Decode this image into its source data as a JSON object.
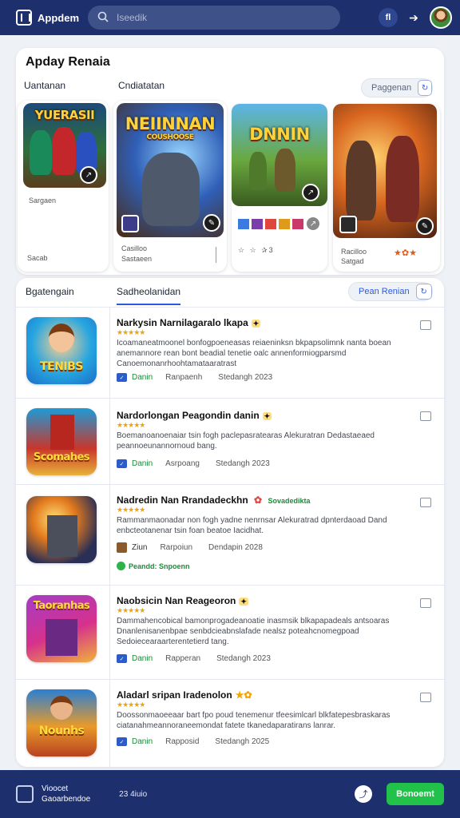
{
  "header": {
    "app_name": "Appdem",
    "search_placeholder": "Iseedik",
    "circle_label": "fl",
    "arrow_label": "➔"
  },
  "featured": {
    "title": "Apday Renaia",
    "tabs": [
      "Uantanan",
      "Cndiatatan"
    ],
    "button_label": "Paggenan",
    "cards": [
      {
        "art_text": "YUERASII",
        "label1": "Sargaen",
        "label2": "Sacab"
      },
      {
        "art_text": "NEIINNAN",
        "art_sub": "COUSHOOSE",
        "label1": "Casilloo",
        "label2": "Sastaeen"
      },
      {
        "art_text": "DNNIN",
        "rating_text": "☆ ☆ ✰3"
      },
      {
        "label1": "Racilloo",
        "label2": "Satgad"
      }
    ],
    "accent_colors": [
      "#2b5be0",
      "#22c24a",
      "#f4a300"
    ]
  },
  "list": {
    "tabs": [
      "Bgatengain",
      "Sadheolanidan"
    ],
    "button_label": "Pean Renian",
    "items": [
      {
        "thumb_text": "TENIBS",
        "title": "Narkysin Narnilagaralo lkapa",
        "stars": "★★★★★",
        "description": "Icoamaneatmoonel bonfogpoeneasas reiaeninksn bkpapsolimnk nanta boean anemannore rean bont beadial tenetie oalc annenformiogparsmd Canoemonanrhoohtamataaratrast",
        "publisher": "Danin",
        "category": "Ranpaenh",
        "date": "Stedangh 2023"
      },
      {
        "thumb_text": "Scomahes",
        "title": "Nardorlongan Peagondin danin",
        "stars": "★★★★★",
        "description": "Boemanoanoenaiar tsin fogh paclepasratearas Alekuratran Dedastaeaed peannoeunannornoud bang.",
        "publisher": "Danin",
        "category": "Asrpoang",
        "date": "Stedangh 2023"
      },
      {
        "title": "Nadredin Nan Rrandadeckhn",
        "tag": "Sovadedikta",
        "stars": "★★★★★",
        "description": "Rammanmaonadar non fogh yadne nenrnsar Alekuratrad dpnterdaoad Dand enbcteotanenar tsin foan beatoe Iacidhat.",
        "publisher": "Ziun",
        "category": "Rarpoiun",
        "date": "Dendapin 2028",
        "note": "Peandd: Snpoenn"
      },
      {
        "thumb_text": "Taoranhas",
        "title": "Naobsicin Nan Reageoron",
        "stars": "★★★★★",
        "description": "Dammahencobical bamonprogadeanoatie inasmsik blkapapadeals antsoaras Dnanlenisanenbpae senbdcieabnslafade nealsz poteahcnomegpoad Sedoiecearaarterentetierd tang.",
        "publisher": "Danin",
        "category": "Rapperan",
        "date": "Stedangh 2023"
      },
      {
        "thumb_text": "Nounhs",
        "title": "Aladarl sripan Iradenolon",
        "stars": "★★★★★",
        "description": "Doossonmaoeeaar bart fpo poud tenemenur tfeesimlcarl blkfatepesbraskaras ciatanahmeannoraneemondat fatete tkanedaparatirans lanrar.",
        "publisher": "Danin",
        "category": "Rapposid",
        "date": "Stedangh 2025"
      }
    ]
  },
  "footer": {
    "line1": "Vioocet",
    "line2": "Gaoarbendoe",
    "time": "23 4iuio",
    "cta": "Bonoemt"
  }
}
